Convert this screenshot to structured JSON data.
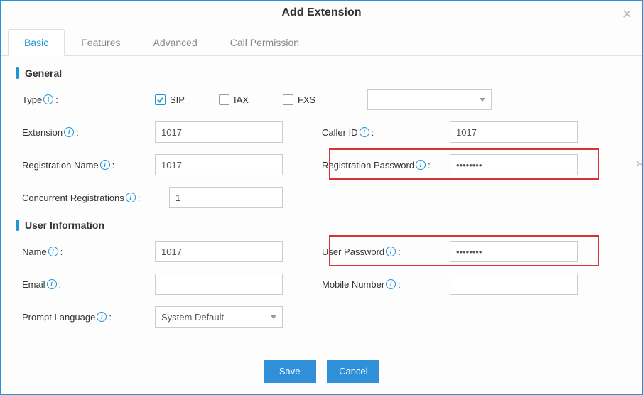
{
  "window": {
    "title": "Add Extension"
  },
  "tabs": [
    {
      "label": "Basic",
      "active": true
    },
    {
      "label": "Features",
      "active": false
    },
    {
      "label": "Advanced",
      "active": false
    },
    {
      "label": "Call Permission",
      "active": false
    }
  ],
  "sections": {
    "general": {
      "title": "General",
      "type_label": "Type",
      "type_options": {
        "sip": "SIP",
        "iax": "IAX",
        "fxs": "FXS"
      },
      "type_checked": {
        "sip": true,
        "iax": false,
        "fxs": false
      },
      "fxs_select": "",
      "extension_label": "Extension",
      "extension_value": "1017",
      "caller_id_label": "Caller ID",
      "caller_id_value": "1017",
      "reg_name_label": "Registration Name",
      "reg_name_value": "1017",
      "reg_password_label": "Registration Password",
      "reg_password_value": "••••••••",
      "concurrent_label": "Concurrent Registrations",
      "concurrent_value": "1"
    },
    "user_info": {
      "title": "User Information",
      "name_label": "Name",
      "name_value": "1017",
      "user_password_label": "User Password",
      "user_password_value": "••••••••",
      "email_label": "Email",
      "email_value": "",
      "mobile_label": "Mobile Number",
      "mobile_value": "",
      "prompt_lang_label": "Prompt Language",
      "prompt_lang_value": "System Default"
    }
  },
  "buttons": {
    "save": "Save",
    "cancel": "Cancel"
  },
  "highlight_color": "#d93232",
  "accent_color": "#2196d6"
}
